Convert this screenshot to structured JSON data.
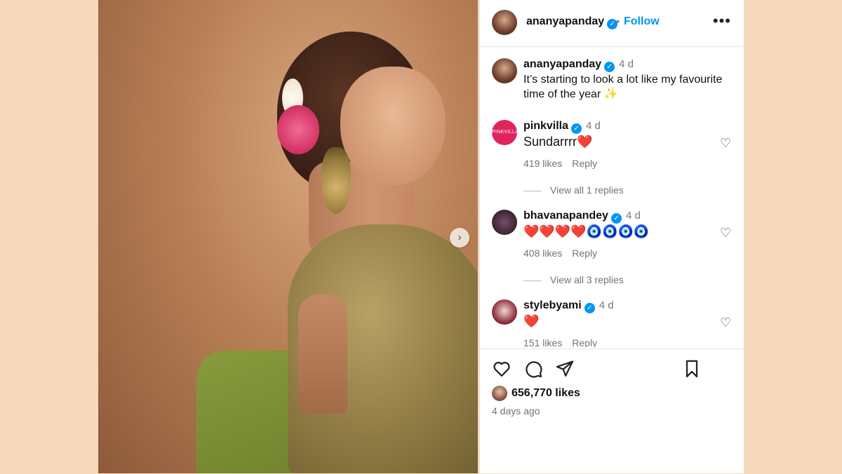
{
  "post": {
    "author": "ananyapanday",
    "follow_label": "Follow",
    "separator": "•",
    "more_label": "•••",
    "caption": {
      "author": "ananyapanday",
      "time": "4 d",
      "text": "It’s starting to look a lot like my favourite time of the year ✨"
    },
    "likes": "656,770 likes",
    "posted": "4 days ago"
  },
  "comments": [
    {
      "author": "pinkvilla",
      "time": "4 d",
      "text": "Sundarrrr❤️",
      "likes": "419 likes",
      "reply": "Reply",
      "view_replies": "View all 1 replies",
      "avatar_text": "PINKVILLA"
    },
    {
      "author": "bhavanapandey",
      "time": "4 d",
      "text": "❤️❤️❤️❤️🧿🧿🧿🧿",
      "likes": "408 likes",
      "reply": "Reply",
      "view_replies": "View all 3 replies"
    },
    {
      "author": "stylebyami",
      "time": "4 d",
      "text": "❤️",
      "likes": "151 likes",
      "reply": "Reply"
    }
  ],
  "icons": [
    "heart-icon",
    "comment-icon",
    "share-icon",
    "bookmark-icon",
    "chevron-right-icon",
    "more-icon",
    "verified-icon"
  ],
  "colors": {
    "accent": "#0095f6",
    "background": "#f6d9bd"
  }
}
